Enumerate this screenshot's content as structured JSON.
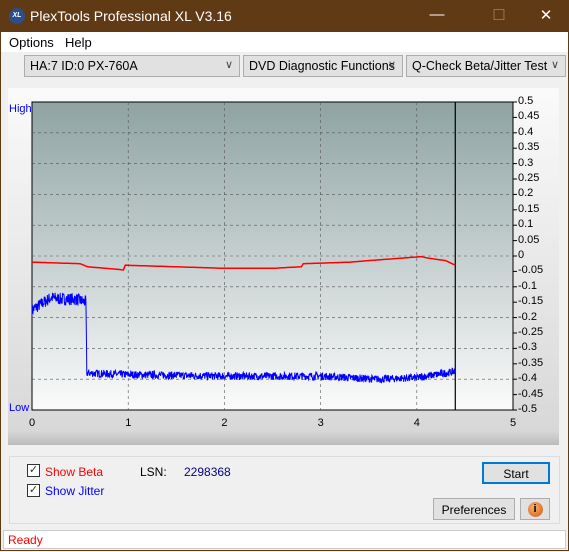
{
  "window": {
    "title": "PlexTools Professional XL V3.16",
    "logo_text": "XL"
  },
  "menu": [
    {
      "label": "Options"
    },
    {
      "label": "Help"
    }
  ],
  "toolbar": {
    "drive": "HA:7 ID:0  PX-760A",
    "function": "DVD Diagnostic Functions",
    "test": "Q-Check Beta/Jitter Test"
  },
  "chart_labels": {
    "high": "High",
    "low": "Low"
  },
  "chart_data": {
    "type": "line",
    "xlim": [
      0,
      5
    ],
    "ylim": [
      -0.5,
      0.5
    ],
    "x_ticks": [
      "0",
      "1",
      "2",
      "3",
      "4",
      "5"
    ],
    "y_ticks": [
      "0.5",
      "0.45",
      "0.4",
      "0.35",
      "0.3",
      "0.25",
      "0.2",
      "0.15",
      "0.1",
      "0.05",
      "0",
      "-0.05",
      "-0.1",
      "-0.15",
      "-0.2",
      "-0.25",
      "-0.3",
      "-0.35",
      "-0.4",
      "-0.45",
      "-0.5"
    ],
    "grid": true,
    "end_marker_x": 4.4,
    "series": [
      {
        "name": "Beta",
        "color": "#ff0000",
        "points": [
          [
            0,
            -0.02
          ],
          [
            0.5,
            -0.025
          ],
          [
            0.58,
            -0.035
          ],
          [
            0.95,
            -0.045
          ],
          [
            0.97,
            -0.03
          ],
          [
            1.5,
            -0.035
          ],
          [
            2,
            -0.04
          ],
          [
            2.5,
            -0.04
          ],
          [
            2.8,
            -0.035
          ],
          [
            2.82,
            -0.025
          ],
          [
            3.3,
            -0.02
          ],
          [
            3.5,
            -0.015
          ],
          [
            4.05,
            -0.002
          ],
          [
            4.1,
            -0.006
          ],
          [
            4.3,
            -0.015
          ],
          [
            4.4,
            -0.03
          ]
        ]
      },
      {
        "name": "Jitter",
        "color": "#0000ff",
        "points": [
          [
            0,
            -0.175
          ],
          [
            0.1,
            -0.155
          ],
          [
            0.2,
            -0.135
          ],
          [
            0.3,
            -0.14
          ],
          [
            0.45,
            -0.14
          ],
          [
            0.56,
            -0.15
          ],
          [
            0.57,
            -0.38
          ],
          [
            1,
            -0.385
          ],
          [
            2,
            -0.39
          ],
          [
            3,
            -0.39
          ],
          [
            3.6,
            -0.4
          ],
          [
            4,
            -0.395
          ],
          [
            4.4,
            -0.375
          ]
        ]
      }
    ]
  },
  "controls": {
    "show_beta": "Show Beta",
    "show_jitter": "Show Jitter",
    "lsn_label": "LSN:",
    "lsn_value": "2298368",
    "start": "Start",
    "preferences": "Preferences"
  },
  "status": "Ready"
}
